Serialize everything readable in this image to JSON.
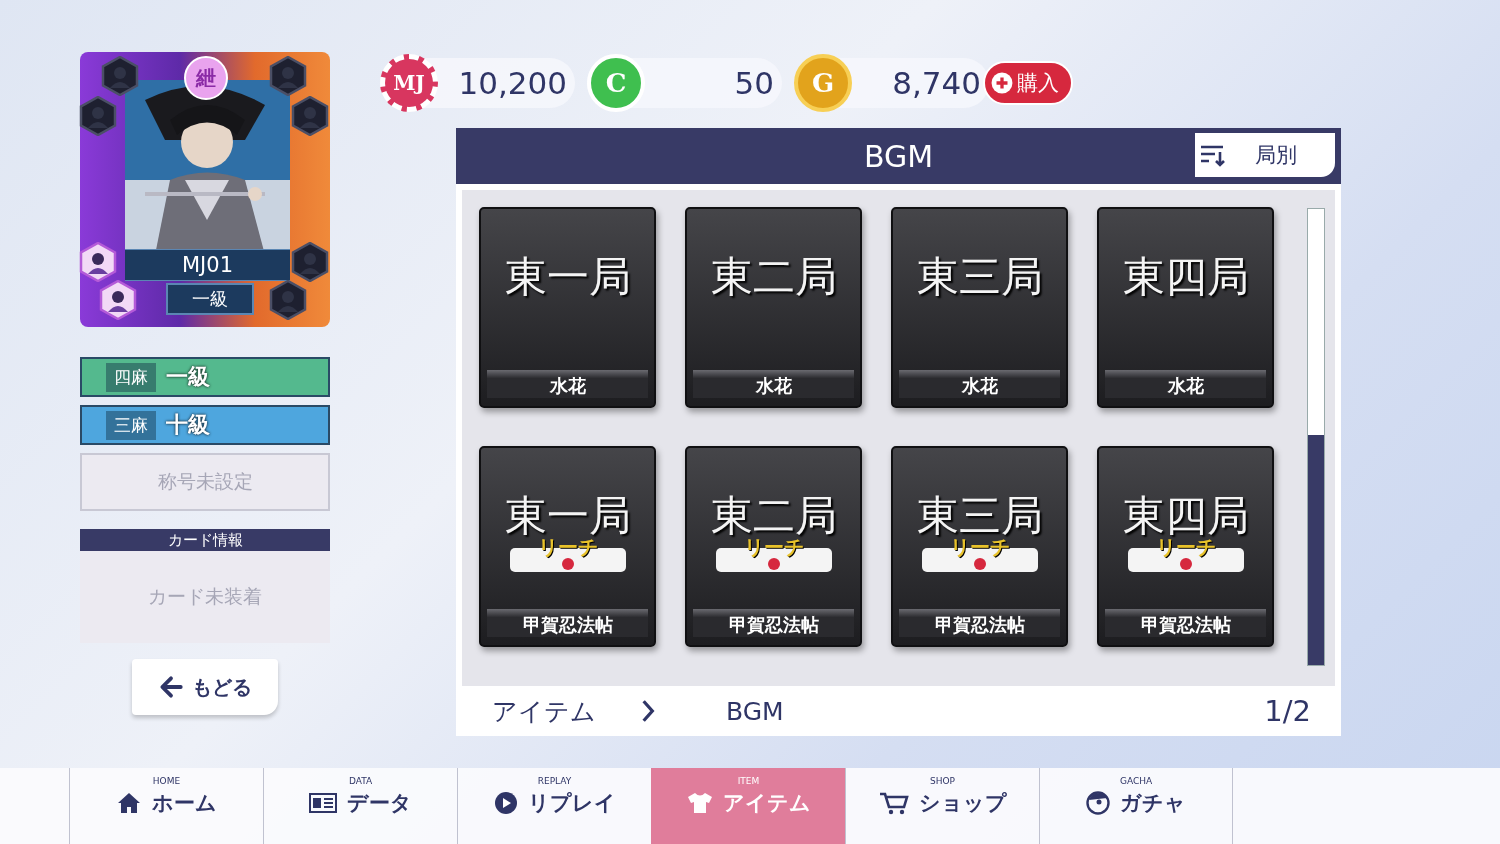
{
  "player": {
    "emblem": "紲",
    "name": "MJ01",
    "rank": "一級",
    "avatar_slots": [
      {
        "unlocked": false
      },
      {
        "unlocked": false
      },
      {
        "unlocked": true
      },
      {
        "unlocked": true
      },
      {
        "unlocked": false
      },
      {
        "unlocked": false
      },
      {
        "unlocked": false
      },
      {
        "unlocked": false
      }
    ]
  },
  "ranks": [
    {
      "mode": "四麻",
      "rank": "一級",
      "color": "#54b98e"
    },
    {
      "mode": "三麻",
      "rank": "十級",
      "color": "#4ea6de"
    }
  ],
  "title_field": {
    "placeholder": "称号未設定"
  },
  "card_info": {
    "header": "カード情報",
    "body": "カード未装着"
  },
  "back_button": "もどる",
  "currencies": [
    {
      "symbol": "MJ",
      "kind": "chip",
      "amount": "10,200"
    },
    {
      "symbol": "C",
      "kind": "green",
      "amount": "50"
    },
    {
      "symbol": "G",
      "kind": "gold",
      "amount": "8,740"
    }
  ],
  "buy_button": "購入",
  "panel": {
    "title": "BGM",
    "sort_button": "局別",
    "tiles": [
      {
        "kind": "plain",
        "title": "東一局",
        "subtitle": "水花"
      },
      {
        "kind": "plain",
        "title": "東二局",
        "subtitle": "水花"
      },
      {
        "kind": "plain",
        "title": "東三局",
        "subtitle": "水花"
      },
      {
        "kind": "plain",
        "title": "東四局",
        "subtitle": "水花"
      },
      {
        "kind": "riichi",
        "title": "東一局",
        "tag": "リーチ",
        "subtitle": "甲賀忍法帖"
      },
      {
        "kind": "riichi",
        "title": "東二局",
        "tag": "リーチ",
        "subtitle": "甲賀忍法帖"
      },
      {
        "kind": "riichi",
        "title": "東三局",
        "tag": "リーチ",
        "subtitle": "甲賀忍法帖"
      },
      {
        "kind": "riichi",
        "title": "東四局",
        "tag": "リーチ",
        "subtitle": "甲賀忍法帖"
      }
    ],
    "breadcrumb": [
      "アイテム",
      "BGM"
    ],
    "page": "1/2"
  },
  "nav": [
    {
      "en": "HOME",
      "label": "ホーム",
      "selected": false
    },
    {
      "en": "DATA",
      "label": "データ",
      "selected": false
    },
    {
      "en": "REPLAY",
      "label": "リプレイ",
      "selected": false
    },
    {
      "en": "ITEM",
      "label": "アイテム",
      "selected": true
    },
    {
      "en": "SHOP",
      "label": "ショップ",
      "selected": false
    },
    {
      "en": "GACHA",
      "label": "ガチャ",
      "selected": false
    }
  ]
}
